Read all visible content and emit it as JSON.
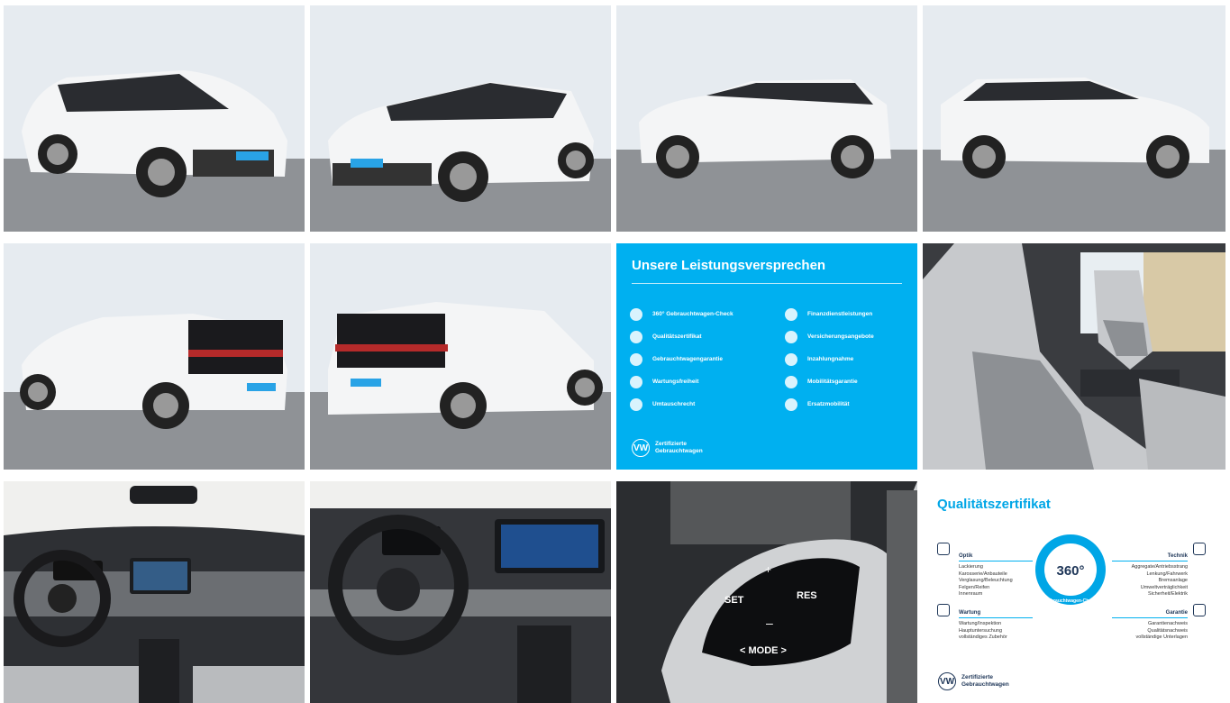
{
  "promise": {
    "title": "Unsere Leistungsversprechen",
    "left_items": [
      "360° Gebrauchtwagen-Check",
      "Qualitätszertifikat",
      "Gebrauchtwagengarantie",
      "Wartungsfreiheit",
      "Umtauschrecht"
    ],
    "right_items": [
      "Finanzdienstleistungen",
      "Versicherungsangebote",
      "Inzahlungnahme",
      "Mobilitätsgarantie",
      "Ersatzmobilität"
    ],
    "footer_line1": "Zertifizierte",
    "footer_line2": "Gebrauchtwagen",
    "logo": "VW",
    "bg_color": "#00b0f0"
  },
  "quality": {
    "title": "Qualitätszertifikat",
    "center_label": "360°",
    "ring_text": "Gebrauchtwagen-Check",
    "optik": {
      "heading": "Optik",
      "items": [
        "Lackierung",
        "Karosserie/Anbauteile",
        "Verglasung/Beleuchtung",
        "Felgen/Reifen",
        "Innenraum"
      ]
    },
    "technik": {
      "heading": "Technik",
      "items": [
        "Aggregate/Antriebsstrang",
        "Lenkung/Fahrwerk",
        "Bremsanlage",
        "Umweltverträglichkeit",
        "Sicherheit/Elektrik"
      ]
    },
    "wartung": {
      "heading": "Wartung",
      "items": [
        "Wartung/Inspektion",
        "Hauptuntersuchung",
        "vollständiges Zubehör"
      ]
    },
    "garantie": {
      "heading": "Garantie",
      "items": [
        "Garantienachweis",
        "Qualitätsnachweis",
        "vollständige Unterlagen"
      ]
    },
    "footer_line1": "Zertifizierte",
    "footer_line2": "Gebrauchtwagen",
    "logo": "VW",
    "accent": "#00a6e6"
  },
  "wheel_buttons": {
    "set": "SET",
    "res": "RES",
    "mode": "< MODE >"
  },
  "colors": {
    "wall": "#e6ebf0",
    "pavement": "#8f9296",
    "car_body": "#f4f5f6",
    "car_roof": "#2a2c30"
  }
}
